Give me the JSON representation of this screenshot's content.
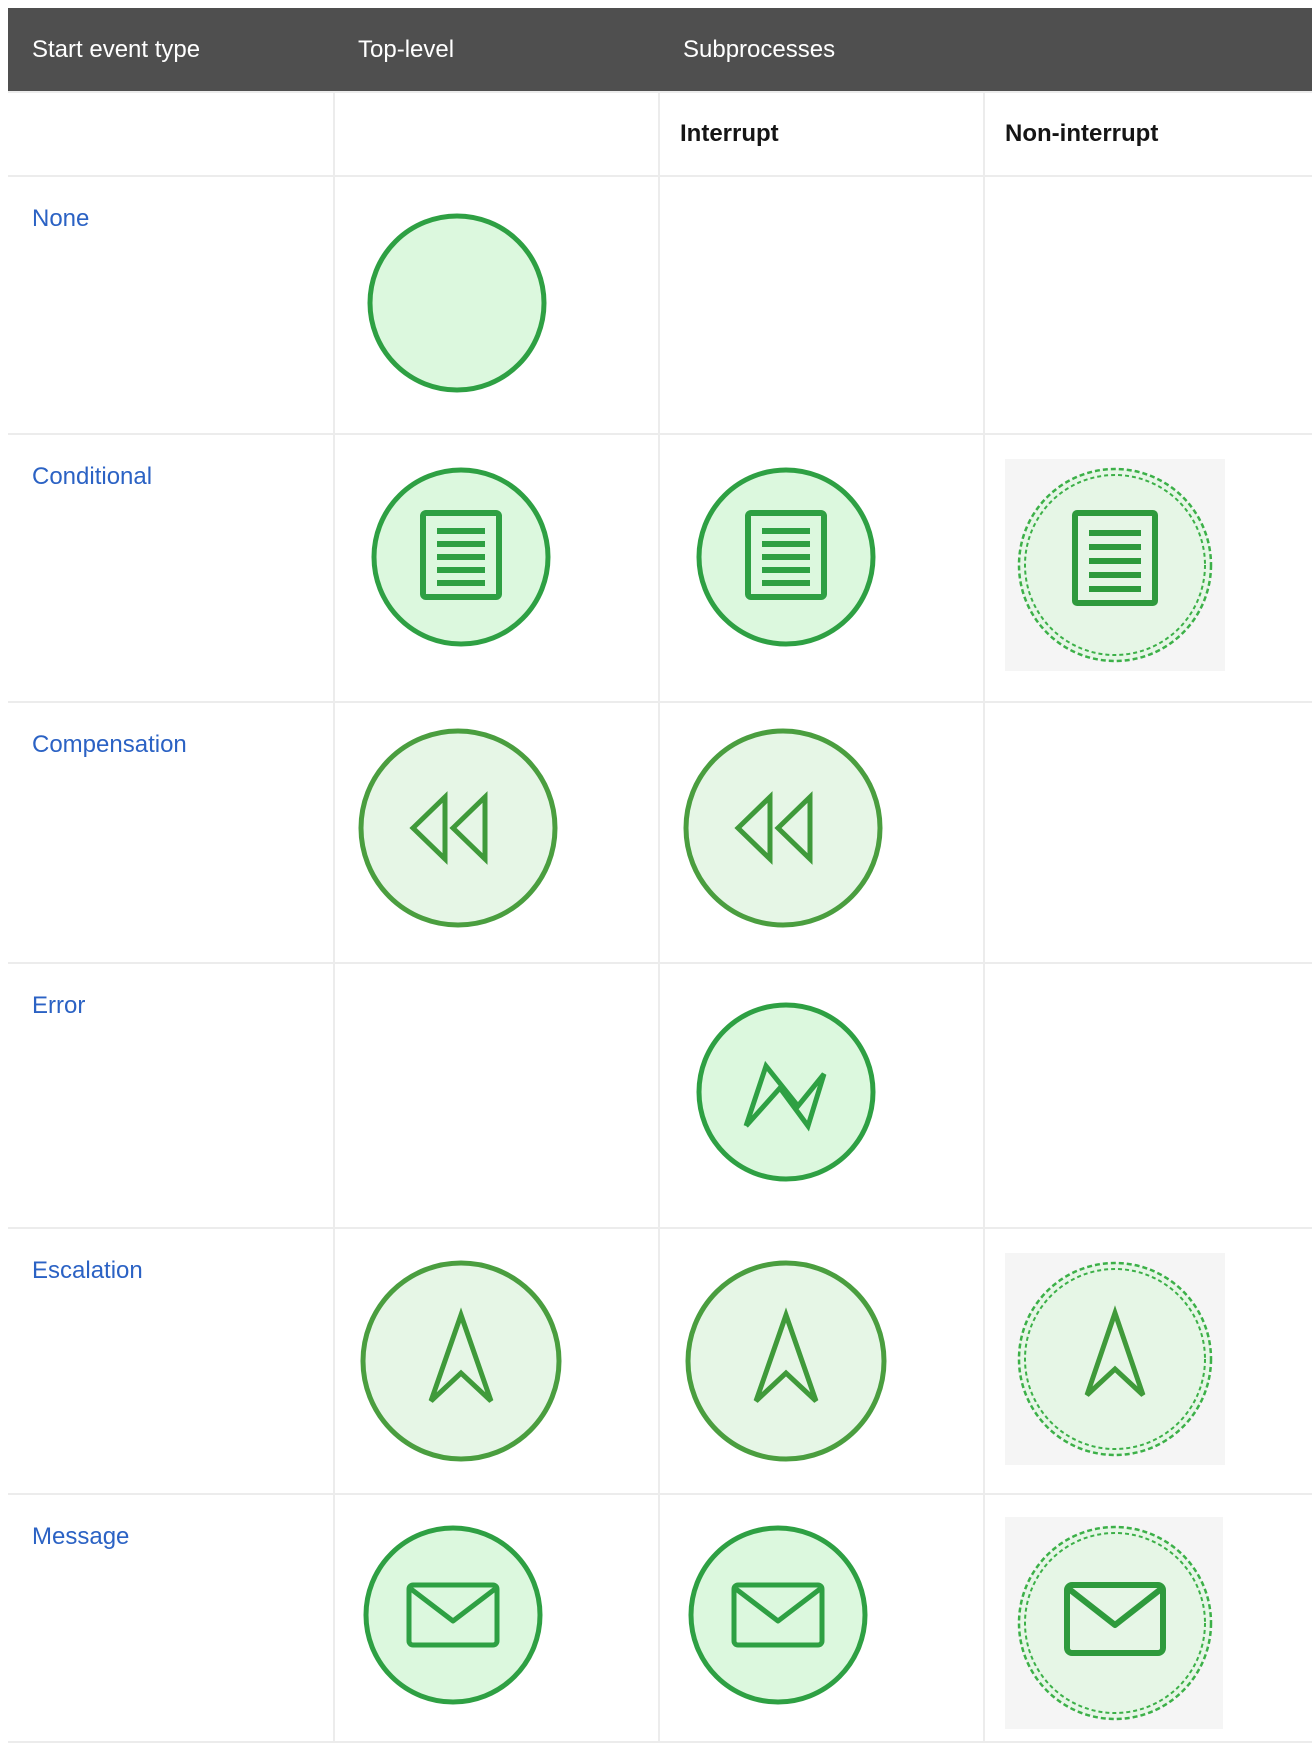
{
  "table": {
    "headers": {
      "start_event_type": "Start event type",
      "top_level": "Top-level",
      "subprocesses": "Subprocesses"
    },
    "subheaders": {
      "interrupt": "Interrupt",
      "non_interrupt": "Non-interrupt"
    },
    "rows": [
      {
        "type": "None",
        "top_level_icon": "none-start-event-icon",
        "interrupt_icon": "",
        "non_interrupt_icon": ""
      },
      {
        "type": "Conditional",
        "top_level_icon": "conditional-start-event-icon",
        "interrupt_icon": "conditional-start-event-icon",
        "non_interrupt_icon": "conditional-non-interrupting-start-event-icon"
      },
      {
        "type": "Compensation",
        "top_level_icon": "compensation-start-event-icon",
        "interrupt_icon": "compensation-start-event-icon",
        "non_interrupt_icon": ""
      },
      {
        "type": "Error",
        "top_level_icon": "",
        "interrupt_icon": "error-start-event-icon",
        "non_interrupt_icon": ""
      },
      {
        "type": "Escalation",
        "top_level_icon": "escalation-start-event-icon",
        "interrupt_icon": "escalation-start-event-icon",
        "non_interrupt_icon": "escalation-non-interrupting-start-event-icon"
      },
      {
        "type": "Message",
        "top_level_icon": "message-start-event-icon",
        "interrupt_icon": "message-start-event-icon",
        "non_interrupt_icon": "message-non-interrupting-start-event-icon"
      }
    ]
  },
  "colors": {
    "header_bg": "#4f4f4f",
    "header_text": "#ffffff",
    "link": "#2b62c4",
    "event_stroke": "#2ea043",
    "event_fill": "#dcf8de",
    "grid": "#ececec"
  }
}
